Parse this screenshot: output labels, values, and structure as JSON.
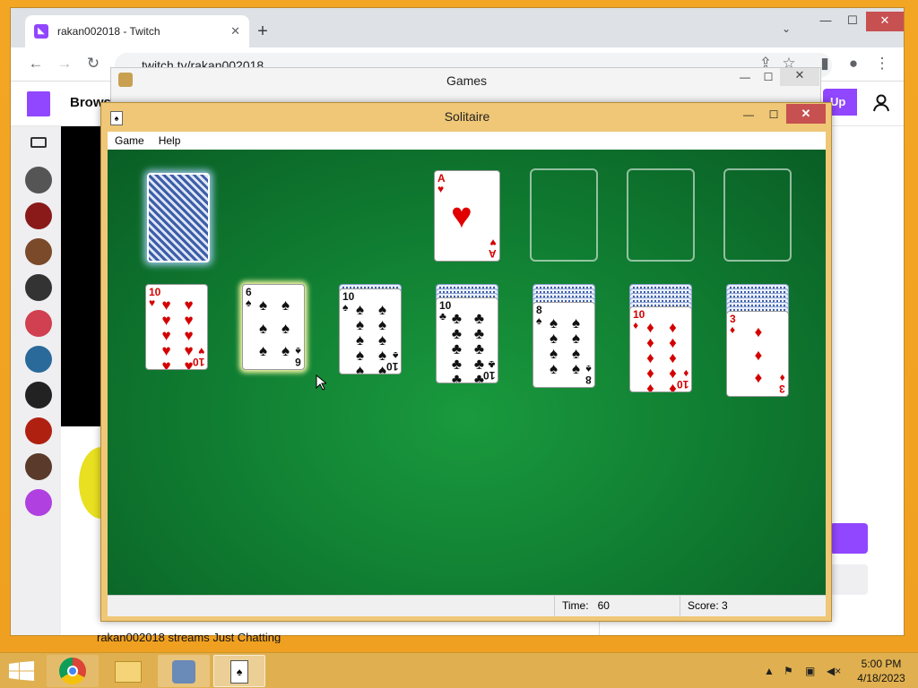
{
  "browser": {
    "tab_title": "rakan002018 - Twitch",
    "url": "twitch.tv/rakan002018",
    "tab_close": "✕",
    "new_tab": "+",
    "tab_search": "⌄"
  },
  "twitch": {
    "browse": "Browse",
    "signup": "Up",
    "stream_caption": "rakan002018 streams Just Chatting"
  },
  "games_window": {
    "title": "Games",
    "minimize": "—",
    "maximize": "☐",
    "close": "✕"
  },
  "solitaire": {
    "title": "Solitaire",
    "minimize": "—",
    "maximize": "☐",
    "close": "✕",
    "menu": [
      "Game",
      "Help"
    ],
    "time_label": "Time:",
    "time_value": "60",
    "score_label": "Score:",
    "score_value": "3",
    "foundation": [
      "A♥",
      "",
      "",
      ""
    ],
    "tableau": [
      {
        "hidden": 0,
        "rank": "10",
        "suit": "♥",
        "color": "red"
      },
      {
        "hidden": 0,
        "rank": "6",
        "suit": "♠",
        "color": "black",
        "selected": true
      },
      {
        "hidden": 1,
        "rank": "10",
        "suit": "♠",
        "color": "black"
      },
      {
        "hidden": 3,
        "rank": "10",
        "suit": "♣",
        "color": "black"
      },
      {
        "hidden": 4,
        "rank": "8",
        "suit": "♠",
        "color": "black"
      },
      {
        "hidden": 5,
        "rank": "10",
        "suit": "♦",
        "color": "red"
      },
      {
        "hidden": 6,
        "rank": "3",
        "suit": "♦",
        "color": "red"
      }
    ]
  },
  "taskbar": {
    "time": "5:00 PM",
    "date": "4/18/2023",
    "apps": [
      "chrome-icon",
      "file-explorer-icon",
      "games-icon",
      "solitaire-icon"
    ]
  },
  "colors": {
    "felt": "#0f7a30",
    "twitch_purple": "#9146ff",
    "close_red": "#c75050",
    "taskbar": "#e0b050"
  }
}
